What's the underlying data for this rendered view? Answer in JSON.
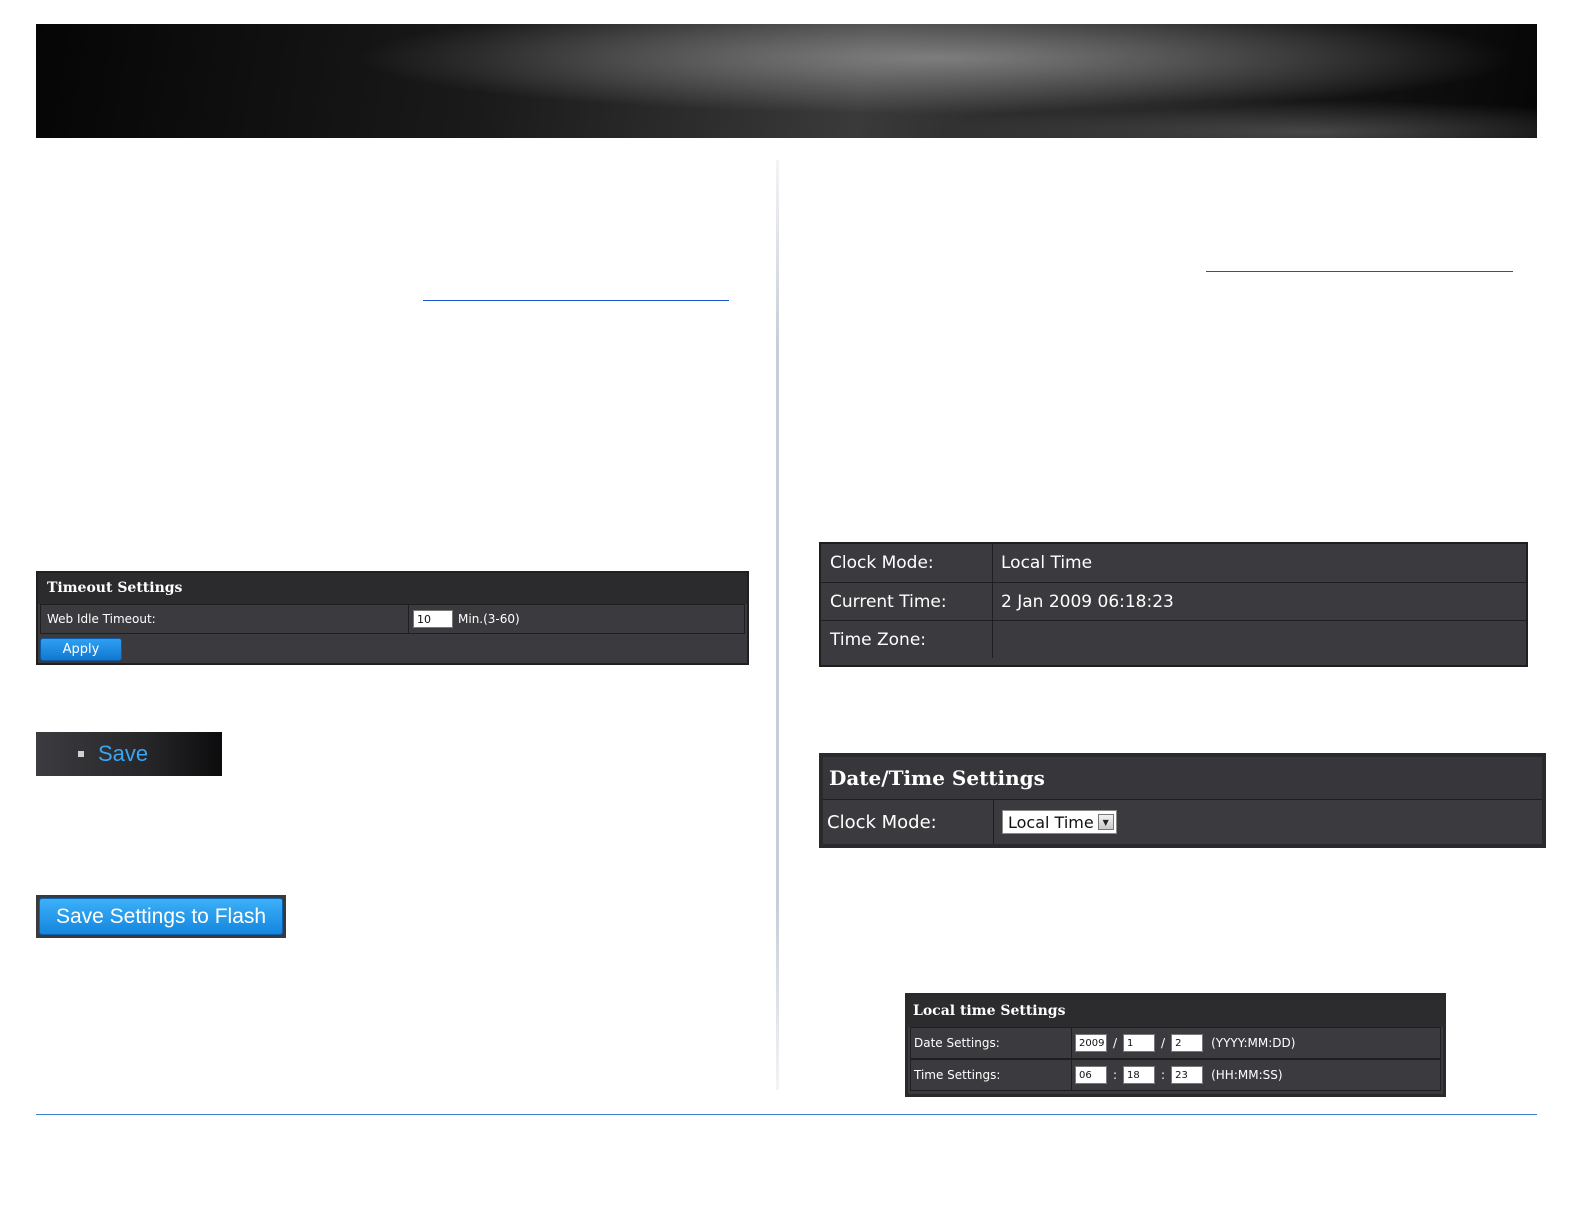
{
  "timeout_panel": {
    "title": "Timeout Settings",
    "label": "Web Idle Timeout:",
    "value": "10",
    "range_hint": "Min.(3-60)",
    "apply_label": "Apply"
  },
  "save_menu": {
    "label": "Save"
  },
  "save_flash": {
    "label": "Save Settings to Flash"
  },
  "clock_info": {
    "rows": [
      {
        "label": "Clock Mode:",
        "value": "Local Time"
      },
      {
        "label": "Current Time:",
        "value": "2 Jan 2009 06:18:23"
      },
      {
        "label": "Time Zone:",
        "value": ""
      }
    ]
  },
  "datetime_settings": {
    "title": "Date/Time Settings",
    "clock_mode_label": "Clock Mode:",
    "clock_mode_value": "Local Time"
  },
  "local_time": {
    "title": "Local time Settings",
    "date_label": "Date Settings:",
    "date_year": "2009",
    "date_month": "1",
    "date_day": "2",
    "date_sep": "/",
    "date_format": "(YYYY:MM:DD)",
    "time_label": "Time Settings:",
    "time_hour": "06",
    "time_minute": "18",
    "time_second": "23",
    "time_sep": ":",
    "time_format": "(HH:MM:SS)"
  },
  "icons": {
    "select_arrow": "chevron-down-icon",
    "menu_bullet": "bullet-icon"
  },
  "colors": {
    "accent": "#1a8be6",
    "link": "#1a53c9",
    "panel": "#3b3b3f"
  }
}
